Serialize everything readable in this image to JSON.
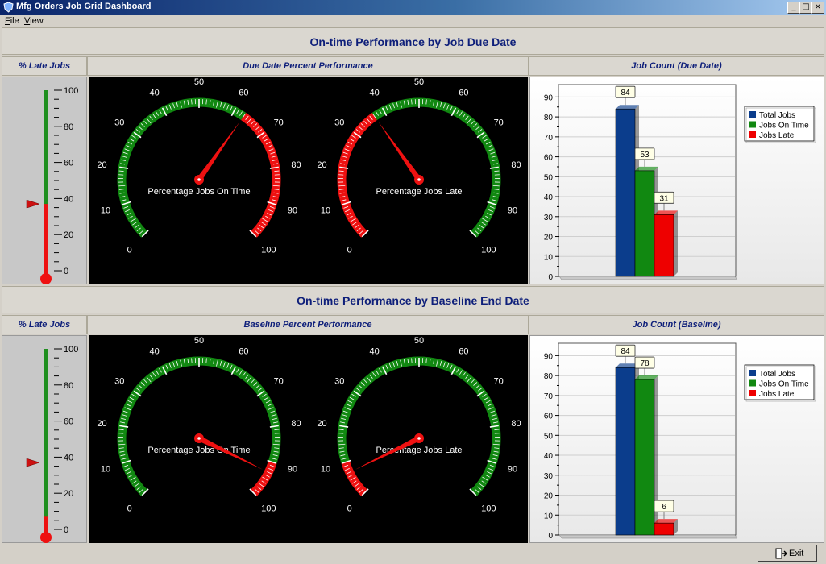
{
  "window": {
    "title": "Mfg Orders Job Grid Dashboard",
    "buttons": {
      "minimize": "_",
      "maximize": "□",
      "close": "×"
    }
  },
  "menu": [
    {
      "label": "File"
    },
    {
      "label": "View"
    }
  ],
  "sections": [
    {
      "title": "On-time Performance by Job Due Date",
      "thermo_header": "% Late Jobs",
      "gauges_header": "Due Date Percent Performance",
      "chart_header": "Job Count (Due Date)",
      "thermometer": {
        "value": 37,
        "marker": 37,
        "max": 100,
        "labels": [
          "100",
          "80",
          "60",
          "40",
          "20",
          "0"
        ]
      },
      "gauges": [
        {
          "label": "Percentage Jobs On Time",
          "value": 63,
          "red_from": 63,
          "red_to": 100,
          "green_from": 0,
          "green_to": 63
        },
        {
          "label": "Percentage Jobs Late",
          "value": 37,
          "red_from": 0,
          "red_to": 37,
          "green_from": 37,
          "green_to": 100
        }
      ],
      "chart_data": {
        "type": "bar",
        "categories": [
          "Total Jobs",
          "Jobs On Time",
          "Jobs Late"
        ],
        "values": [
          84,
          53,
          31
        ],
        "colors": [
          "#0b3d8c",
          "#118811",
          "#ee0000"
        ],
        "ylim": [
          0,
          95
        ],
        "yticks": [
          0,
          10,
          20,
          30,
          40,
          50,
          60,
          70,
          80,
          90
        ],
        "legend": "top-right",
        "grid": true
      }
    },
    {
      "title": "On-time Performance by Baseline End Date",
      "thermo_header": "% Late Jobs",
      "gauges_header": "Baseline Percent Performance",
      "chart_header": "Job Count (Baseline)",
      "thermometer": {
        "value": 7,
        "marker": 37,
        "max": 100,
        "labels": [
          "100",
          "80",
          "60",
          "40",
          "20",
          "0"
        ]
      },
      "gauges": [
        {
          "label": "Percentage Jobs On Time",
          "value": 93,
          "red_from": 90,
          "red_to": 100,
          "green_from": 0,
          "green_to": 90
        },
        {
          "label": "Percentage Jobs Late",
          "value": 7,
          "red_from": 0,
          "red_to": 10,
          "green_from": 10,
          "green_to": 100
        }
      ],
      "chart_data": {
        "type": "bar",
        "categories": [
          "Total Jobs",
          "Jobs On Time",
          "Jobs Late"
        ],
        "values": [
          84,
          78,
          6
        ],
        "colors": [
          "#0b3d8c",
          "#118811",
          "#ee0000"
        ],
        "ylim": [
          0,
          95
        ],
        "yticks": [
          0,
          10,
          20,
          30,
          40,
          50,
          60,
          70,
          80,
          90
        ],
        "legend": "top-right",
        "grid": true
      }
    }
  ],
  "gauge_tick_labels": [
    "0",
    "10",
    "20",
    "30",
    "40",
    "50",
    "60",
    "70",
    "80",
    "90",
    "100"
  ],
  "exit_button": {
    "label": "Exit"
  },
  "icons": {
    "app": "shield-icon",
    "exit": "exit-door-icon"
  }
}
